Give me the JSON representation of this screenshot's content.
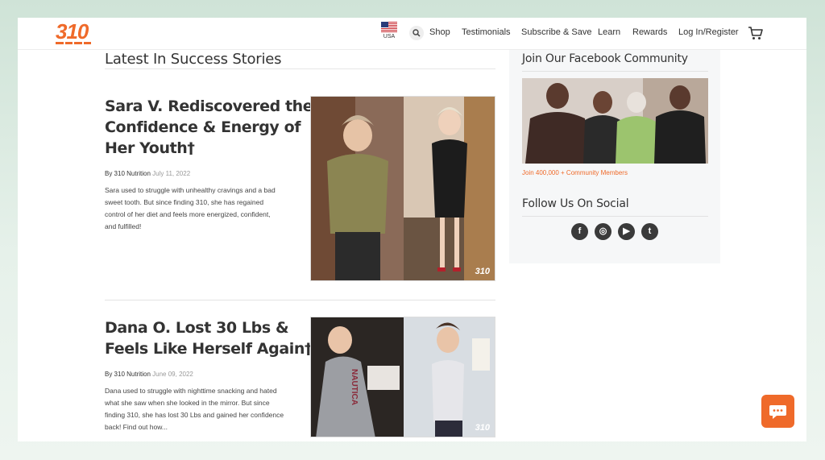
{
  "header": {
    "logo_text": "310",
    "region_label": "USA",
    "nav": [
      "Shop",
      "Testimonials",
      "Subscribe & Save",
      "Learn",
      "Rewards",
      "Log In/Register"
    ]
  },
  "main": {
    "section_title": "Latest In Success Stories",
    "stories": [
      {
        "title_lines": [
          "Sara V. Rediscovered the",
          "Confidence & Energy of",
          "Her Youth†"
        ],
        "by": "By 310 Nutrition",
        "date": "July 11, 2022",
        "excerpt_lines": [
          "Sara used to struggle with unhealthy cravings and a bad",
          "sweet tooth. But since finding 310, she has regained",
          "control of her diet and feels more energized, confident,",
          "and fulfilled!"
        ],
        "badge": "310"
      },
      {
        "title_lines": [
          "Dana O. Lost 30 Lbs &",
          "Feels Like Herself Again†"
        ],
        "by": "By 310 Nutrition",
        "date": "June 09, 2022",
        "excerpt_lines": [
          "Dana used to struggle with nighttime snacking and hated",
          "what she saw when she looked in the mirror. But since",
          "finding 310, she has lost 30 Lbs and gained her confidence",
          "back! Find out how..."
        ],
        "badge": "310",
        "shirt_text": "NAUTICA"
      }
    ]
  },
  "sidebar": {
    "community_title": "Join Our Facebook Community",
    "community_link": "Join 400,000 + Community Members",
    "social_title": "Follow Us On Social",
    "social_glyphs": [
      "f",
      "◎",
      "▶",
      "t"
    ]
  },
  "colors": {
    "brand_orange": "#ef6a2a",
    "text_dark": "#333333"
  },
  "icons": [
    "us-flag-icon",
    "search-icon",
    "cart-icon",
    "facebook-icon",
    "instagram-icon",
    "youtube-icon",
    "twitter-icon",
    "chat-icon"
  ]
}
